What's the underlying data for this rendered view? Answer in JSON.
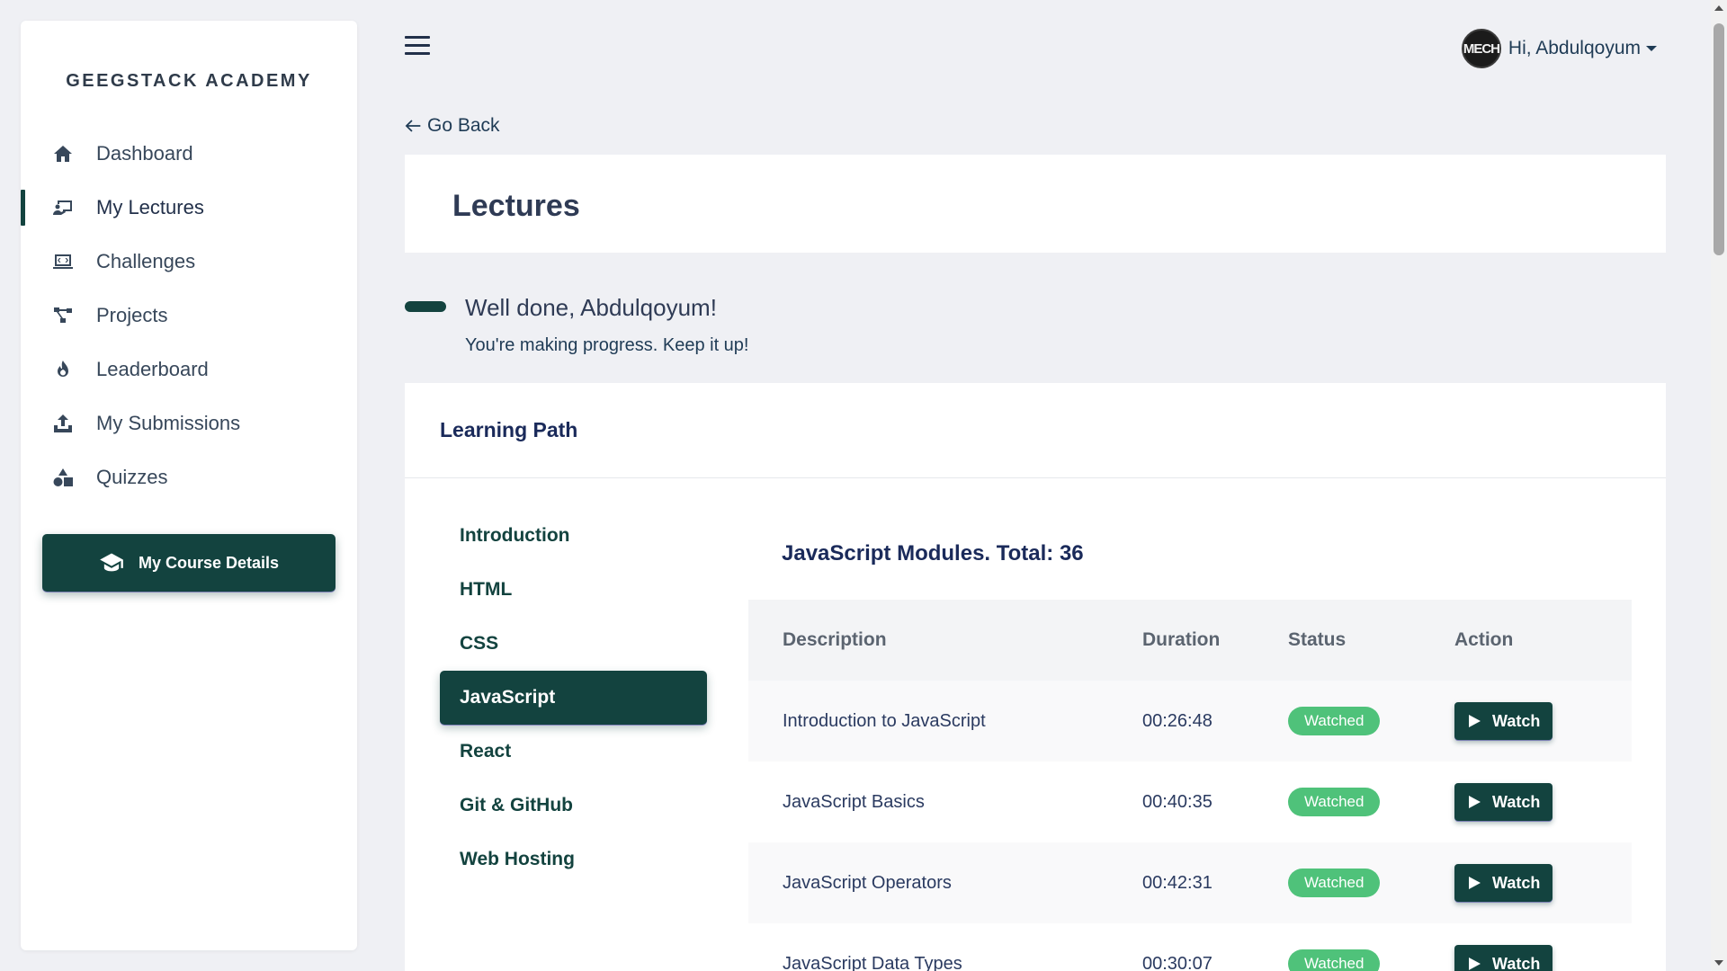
{
  "sidebar": {
    "brand": "GEEGSTACK ACADEMY",
    "items": [
      {
        "label": "Dashboard",
        "icon": "home-icon"
      },
      {
        "label": "My Lectures",
        "icon": "lectures-icon",
        "active": true
      },
      {
        "label": "Challenges",
        "icon": "challenges-icon"
      },
      {
        "label": "Projects",
        "icon": "projects-icon"
      },
      {
        "label": "Leaderboard",
        "icon": "fire-icon"
      },
      {
        "label": "My Submissions",
        "icon": "upload-icon"
      },
      {
        "label": "Quizzes",
        "icon": "shapes-icon"
      }
    ],
    "course_button": "My Course Details"
  },
  "header": {
    "user_greeting": "Hi, Abdulqoyum",
    "avatar_text": "MECH"
  },
  "go_back": "Go Back",
  "page_title": "Lectures",
  "progress": {
    "headline": "Well done, Abdulqoyum!",
    "message": "You're making progress. Keep it up!"
  },
  "learning_path": {
    "title": "Learning Path",
    "tabs": [
      "Introduction",
      "HTML",
      "CSS",
      "JavaScript",
      "React",
      "Git & GitHub",
      "Web Hosting"
    ],
    "active_tab": "JavaScript",
    "modules_title": "JavaScript Modules. Total: 36",
    "columns": [
      "Description",
      "Duration",
      "Status",
      "Action"
    ],
    "rows": [
      {
        "description": "Introduction to JavaScript",
        "duration": "00:26:48",
        "status": "Watched",
        "action": "Watch"
      },
      {
        "description": "JavaScript Basics",
        "duration": "00:40:35",
        "status": "Watched",
        "action": "Watch"
      },
      {
        "description": "JavaScript Operators",
        "duration": "00:42:31",
        "status": "Watched",
        "action": "Watch"
      },
      {
        "description": "JavaScript Data Types",
        "duration": "00:30:07",
        "status": "Watched",
        "action": "Watch"
      }
    ]
  },
  "colors": {
    "primary": "#13433f",
    "watched_badge": "#4fc27a",
    "background": "#eff0f4"
  }
}
